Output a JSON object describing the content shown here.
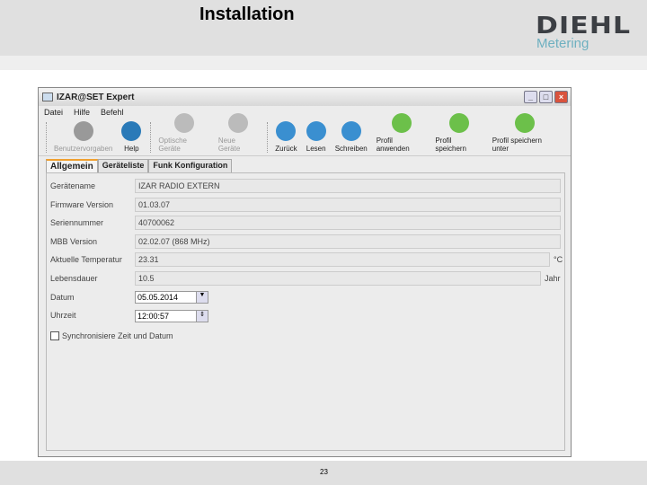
{
  "slide": {
    "title": "Installation",
    "logo_main": "DIEHL",
    "logo_sub": "Metering",
    "page": "23"
  },
  "window": {
    "title": "IZAR@SET Expert",
    "buttons": {
      "minimize": "_",
      "maximize": "□",
      "close": "×"
    }
  },
  "menu": [
    "Datei",
    "Hilfe",
    "Befehl"
  ],
  "toolbar": [
    {
      "label": "Benutzervorgaben",
      "icon": "gear-icon",
      "enabled": false,
      "color": "#999999"
    },
    {
      "label": "Help",
      "icon": "help-globe-icon",
      "enabled": true,
      "color": "#2a7ab8"
    },
    {
      "label": "Optische Geräte",
      "icon": "optical-device-icon",
      "enabled": false,
      "color": "#bbbbbb"
    },
    {
      "label": "Neue Geräte",
      "icon": "new-device-icon",
      "enabled": false,
      "color": "#bbbbbb"
    },
    {
      "label": "Zurück",
      "icon": "arrow-up-icon",
      "enabled": true,
      "color": "#3a8fd0"
    },
    {
      "label": "Lesen",
      "icon": "read-icon",
      "enabled": true,
      "color": "#3a8fd0"
    },
    {
      "label": "Schreiben",
      "icon": "write-icon",
      "enabled": true,
      "color": "#3a8fd0"
    },
    {
      "label": "Profil anwenden",
      "icon": "profile-apply-icon",
      "enabled": true,
      "color": "#6cc04a"
    },
    {
      "label": "Profil speichern",
      "icon": "profile-save-icon",
      "enabled": true,
      "color": "#6cc04a"
    },
    {
      "label": "Profil speichern unter",
      "icon": "profile-save-as-icon",
      "enabled": true,
      "color": "#6cc04a"
    }
  ],
  "tabs": [
    "Allgemein",
    "Geräteliste",
    "Funk Konfiguration"
  ],
  "fields": [
    {
      "label": "Gerätename",
      "value": "IZAR RADIO EXTERN",
      "unit": ""
    },
    {
      "label": "Firmware Version",
      "value": "01.03.07",
      "unit": ""
    },
    {
      "label": "Seriennummer",
      "value": "40700062",
      "unit": ""
    },
    {
      "label": "MBB Version",
      "value": "02.02.07 (868 MHz)",
      "unit": ""
    },
    {
      "label": "Aktuelle Temperatur",
      "value": "23.31",
      "unit": "°C"
    },
    {
      "label": "Lebensdauer",
      "value": "10.5",
      "unit": "Jahr"
    }
  ],
  "datum": {
    "label": "Datum",
    "value": "05.05.2014"
  },
  "uhrzeit": {
    "label": "Uhrzeit",
    "value": "12:00:57"
  },
  "sync": {
    "label": "Synchronisiere Zeit und Datum",
    "checked": false
  }
}
